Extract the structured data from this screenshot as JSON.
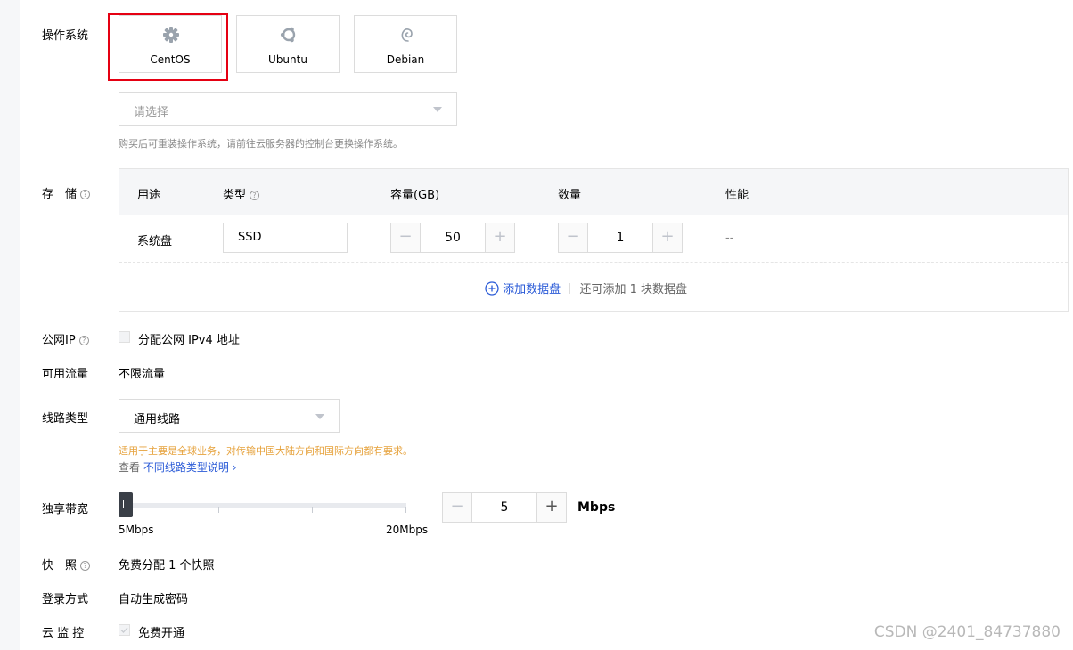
{
  "os": {
    "label": "操作系统",
    "options": [
      {
        "name": "CentOS",
        "icon": "centos-icon"
      },
      {
        "name": "Ubuntu",
        "icon": "ubuntu-icon"
      },
      {
        "name": "Debian",
        "icon": "debian-icon"
      }
    ],
    "version_placeholder": "请选择",
    "hint": "购买后可重装操作系统，请前往云服务器的控制台更换操作系统。"
  },
  "storage": {
    "label": "存　储",
    "columns": [
      "用途",
      "类型",
      "容量(GB)",
      "数量",
      "性能"
    ],
    "row": {
      "usage": "系统盘",
      "type": "SSD",
      "capacity": "50",
      "quantity": "1",
      "performance": "--"
    },
    "add_disk": "添加数据盘",
    "add_disk_hint": "还可添加 1 块数据盘"
  },
  "public_ip": {
    "label": "公网IP",
    "option": "分配公网 IPv4 地址"
  },
  "traffic": {
    "label": "可用流量",
    "value": "不限流量"
  },
  "line": {
    "label": "线路类型",
    "value": "通用线路",
    "warning": "适用于主要是全球业务，对传输中国大陆方向和国际方向都有要求。",
    "view": "查看",
    "link": "不同线路类型说明",
    "link_arrow": "›"
  },
  "bandwidth": {
    "label": "独享带宽",
    "min_label": "5Mbps",
    "max_label": "20Mbps",
    "value": "5",
    "unit": "Mbps",
    "slider_value": 5,
    "slider_min": 5,
    "slider_max": 20
  },
  "snapshot": {
    "label": "快　照",
    "value": "免费分配 1 个快照"
  },
  "login": {
    "label": "登录方式",
    "value": "自动生成密码"
  },
  "monitor": {
    "label": "云 监 控",
    "option": "免费开通"
  },
  "stepper": {
    "minus": "−",
    "plus": "+"
  },
  "watermark": "CSDN @2401_84737880",
  "colors": {
    "accent": "#2b5bd7",
    "selected_border": "#e50012",
    "warning": "#e6a23c"
  }
}
